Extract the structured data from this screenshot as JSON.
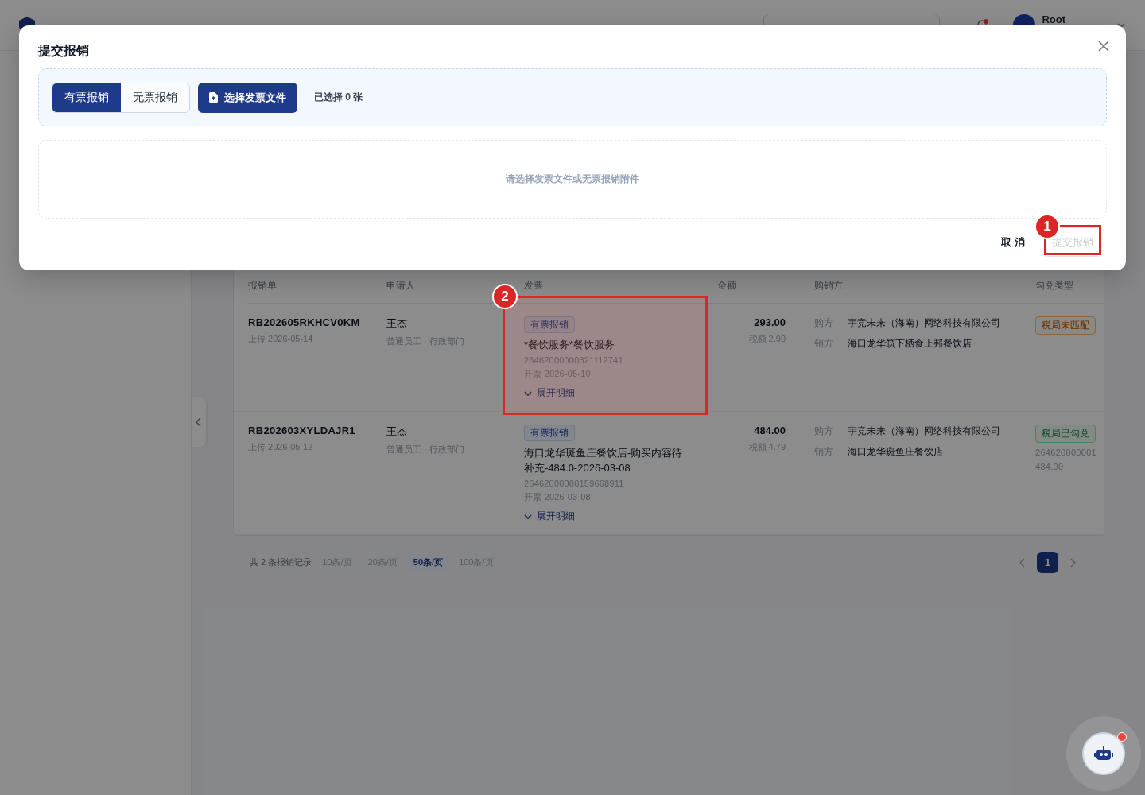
{
  "header": {
    "user": {
      "name": "Root"
    }
  },
  "modal": {
    "title": "提交报销",
    "mode_tabs": [
      {
        "label": "有票报销",
        "selected": true
      },
      {
        "label": "无票报销",
        "selected": false
      }
    ],
    "select_button": "选择发票文件",
    "selected_count": "已选择 0 张",
    "empty_hint": "请选择发票文件或无票报销附件",
    "cancel": "取 消",
    "submit": {
      "label": "提交报销",
      "disabled": true
    }
  },
  "table": {
    "columns": [
      "报销单",
      "申请人",
      "发票",
      "金额",
      "购销方",
      "勾兑类型"
    ],
    "rows": [
      {
        "id": "RB202605RKHCV0KM",
        "uploaded": "上传 2026-05-14",
        "applicant": "王杰",
        "role": "普通员工 · 行政部门",
        "invoice": {
          "tag": "有票报销",
          "title": "*餐饮服务*餐饮服务",
          "number": "26462000000321112741",
          "date": "开票 2026-05-10",
          "expand": "展开明细"
        },
        "amount": "293.00",
        "tax": "税额 2.90",
        "parties": [
          {
            "label": "购方",
            "name": "宇竞未来（海南）网络科技有限公司"
          },
          {
            "label": "销方",
            "name": "海口龙华筑下栖食上邦餐饮店"
          }
        ],
        "match": {
          "label": "税局未匹配",
          "kind": "warning"
        }
      },
      {
        "id": "RB202603XYLDAJR1",
        "uploaded": "上传 2026-05-12",
        "applicant": "王杰",
        "role": "普通员工 · 行政部门",
        "invoice": {
          "tag": "有票报销",
          "title": "海口龙华斑鱼庄餐饮店-购买内容待补充-484.0-2026-03-08",
          "number": "26462000000159668911",
          "date": "开票 2026-03-08",
          "expand": "展开明细"
        },
        "amount": "484.00",
        "tax": "税额 4.79",
        "parties": [
          {
            "label": "购方",
            "name": "宇竞未来（海南）网络科技有限公司"
          },
          {
            "label": "销方",
            "name": "海口龙华斑鱼庄餐饮店"
          }
        ],
        "match": {
          "label": "税局已勾兑",
          "kind": "success",
          "details": [
            "264620000001",
            "484.00"
          ]
        }
      }
    ]
  },
  "pagination": {
    "total": "共 2 条报销记录",
    "sizes": [
      {
        "label": "10条/页",
        "selected": false
      },
      {
        "label": "20条/页",
        "selected": false
      },
      {
        "label": "50条/页",
        "selected": true
      },
      {
        "label": "100条/页",
        "selected": false
      }
    ],
    "pages": [
      {
        "label": "1",
        "selected": true
      }
    ]
  },
  "assistant": {
    "unread": true
  },
  "annotations": [
    {
      "number": "1"
    },
    {
      "number": "2"
    }
  ]
}
